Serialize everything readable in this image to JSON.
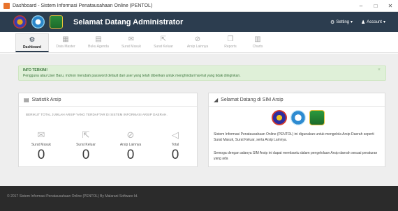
{
  "window": {
    "title": "Dashboard - Sistem Informasi Penatausahaan Online (PENTOL)",
    "controls": [
      "–",
      "□",
      "✕"
    ]
  },
  "navbar": {
    "brand": "Selamat Datang Administrator",
    "setting": "Setting",
    "account": "Account"
  },
  "tabs": [
    {
      "label": "Dashboard",
      "icon": "dashboard-icon",
      "glyph": "⚙",
      "active": true
    },
    {
      "label": "Data Master",
      "icon": "database-icon",
      "glyph": "▦",
      "active": false
    },
    {
      "label": "Buku Agenda",
      "icon": "book-icon",
      "glyph": "▤",
      "active": false
    },
    {
      "label": "Surat Masuk",
      "icon": "mail-icon",
      "glyph": "✉",
      "active": false
    },
    {
      "label": "Surat Keluar",
      "icon": "export-icon",
      "glyph": "⇱",
      "active": false
    },
    {
      "label": "Arsip Lainnya",
      "icon": "paperclip-icon",
      "glyph": "⊘",
      "active": false
    },
    {
      "label": "Reports",
      "icon": "copy-icon",
      "glyph": "❐",
      "active": false
    },
    {
      "label": "Charts",
      "icon": "chart-icon",
      "glyph": "▥",
      "active": false
    }
  ],
  "alert": {
    "title": "INFO TERKINI!",
    "message": "Pengguna atau User Baru, mohon merubah password default dari user yang telah diberikan untuk menghindari hal-hal yang tidak diinginkan.",
    "close": "×"
  },
  "statistik": {
    "title": "Statistik Arsip",
    "note": "BERIKUT TOTAL JUMLAH ARSIP YANG TERDAFTAR DI SISTEM INFORMASI ARSIP DAERAH.",
    "items": [
      {
        "label": "Surat Masuk",
        "value": "0",
        "icon": "envelope-icon",
        "glyph": "✉"
      },
      {
        "label": "Surat Keluar",
        "value": "0",
        "icon": "share-icon",
        "glyph": "⇱"
      },
      {
        "label": "Arsip Lainnya",
        "value": "0",
        "icon": "paperclip-icon",
        "glyph": "⊘"
      },
      {
        "label": "Total",
        "value": "0",
        "icon": "bullhorn-icon",
        "glyph": "◁"
      }
    ]
  },
  "welcome": {
    "title": "Selamat Datang di SIM Arsip",
    "text1": "Sistem Informasi Penatausahaan Online (PENTOL) ini digunakan untuk mengelola Arsip Daerah seperti Surat Masuk, Surat Keluar, serta Arsip Lainnya.",
    "text2": "Semoga dengan adanya SIM Arsip ini dapat membantu dalam pengelolaan Arsip daerah sesuai peraturan yang ada"
  },
  "footer": {
    "text": "© 2017 Sistem Informasi Penatausahaan Online (PENTOL) By Malarani Software Id."
  },
  "colors": {
    "navbar": "#2c3d4f",
    "alert_bg": "#dff0d8",
    "footer": "#2b2b2b"
  }
}
